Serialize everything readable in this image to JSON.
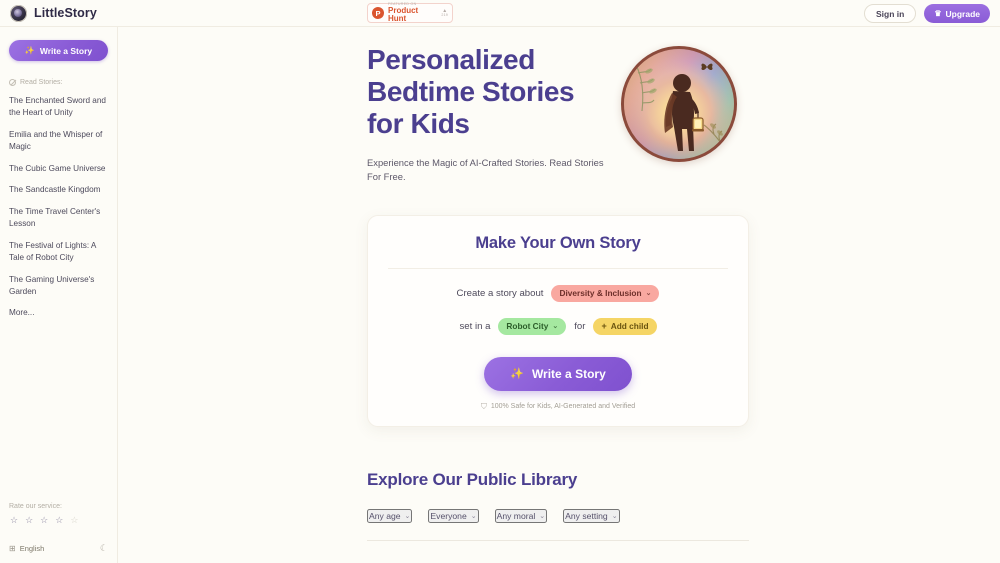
{
  "brand": {
    "name": "LittleStory",
    "logo_icon": "owl-badge-icon"
  },
  "topbar": {
    "product_hunt": {
      "pre_text": "FEATURED ON",
      "name": "Product Hunt",
      "logo_letter": "P",
      "upvote_caret": "▲",
      "upvote_count": "219"
    },
    "sign_in_label": "Sign in",
    "upgrade_label": "Upgrade",
    "upgrade_icon": "crown-icon",
    "crown_glyph": "♛"
  },
  "sidebar": {
    "write_button": {
      "label": "Write a Story",
      "icon": "magic-wand-icon",
      "glyph": "✨"
    },
    "read_stories_label": "Read Stories:",
    "read_icon": "no-entry-icon",
    "stories": [
      {
        "title": "The Enchanted Sword and the Heart of Unity"
      },
      {
        "title": "Emilia and the Whisper of Magic"
      },
      {
        "title": "The Cubic Game Universe"
      },
      {
        "title": "The Sandcastle Kingdom"
      },
      {
        "title": "The Time Travel Center's Lesson"
      },
      {
        "title": "The Festival of Lights: A Tale of Robot City"
      },
      {
        "title": "The Gaming Universe's Garden"
      }
    ],
    "more_label": "More...",
    "rate_label": "Rate our service:",
    "stars": {
      "filled": 4,
      "total": 5,
      "glyph": "☆"
    },
    "language": {
      "label": "English",
      "icon": "globe-icon",
      "glyph": "⊞"
    },
    "theme_toggle": {
      "icon": "moon-icon",
      "glyph": "☾"
    }
  },
  "hero": {
    "title_line1": "Personalized",
    "title_line2": "Bedtime Stories",
    "title_line3": "for Kids",
    "subtitle": "Experience the Magic of AI-Crafted Stories. Read Stories For Free.",
    "art": {
      "name": "child-with-lantern-illustration",
      "alt": "Silhouette of a child holding a lantern in a glowing forest circle"
    }
  },
  "story_builder": {
    "title": "Make Your Own Story",
    "about_label": "Create a story about",
    "topic_value": "Diversity & Inclusion",
    "setting_label": "set in a",
    "setting_value": "Robot City",
    "for_label": "for",
    "add_child_label": "Add child",
    "add_child_plus": "+",
    "chevron": "⌄",
    "cta_label": "Write a Story",
    "cta_icon": "magic-wand-icon",
    "cta_glyph": "✨",
    "safety_note": "100% Safe for Kids, AI-Generated and Verified",
    "safety_icon": "shield-check-icon",
    "safety_glyph": "⛉"
  },
  "explore": {
    "title": "Explore Our Public Library",
    "filters": [
      {
        "label": "Any age"
      },
      {
        "label": "Everyone"
      },
      {
        "label": "Any moral"
      },
      {
        "label": "Any setting"
      }
    ],
    "chevron": "⌄"
  },
  "colors": {
    "page_bg": "#fdfcf7",
    "brand_purple": "#8a5cd6",
    "heading_purple": "#4b3f8f",
    "pill_topic": "#f9a8a0",
    "pill_setting": "#a5e8a0",
    "pill_child": "#f5d565",
    "product_hunt_orange": "#da552f"
  }
}
